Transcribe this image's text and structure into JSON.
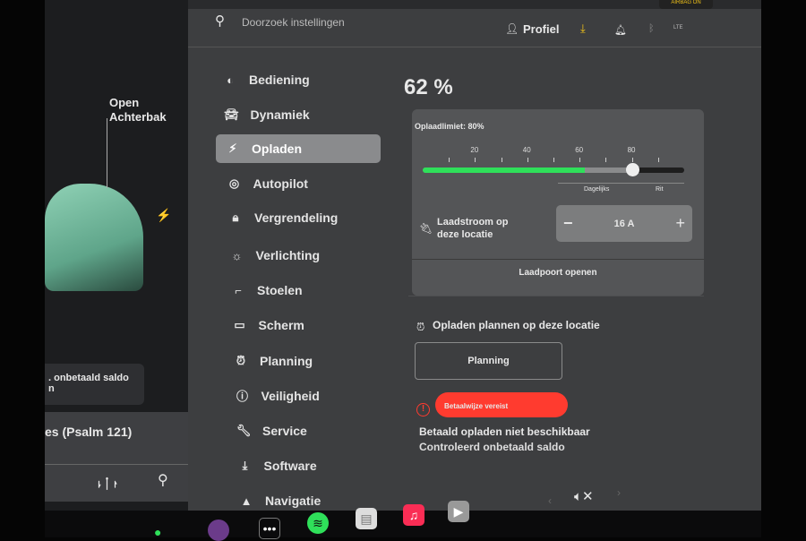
{
  "left_panel": {
    "trunk_label_1": "Open",
    "trunk_label_2": "Achterbak",
    "notice": ". onbetaald saldo",
    "notice_2": "n",
    "media_title": "es (Psalm 121)"
  },
  "header": {
    "search_placeholder": "Doorzoek instellingen",
    "profile": "Profiel",
    "airbag": "AIRBAG ON",
    "lte": "LTE"
  },
  "menu": [
    {
      "label": "Bediening",
      "icon": "toggle-icon"
    },
    {
      "label": "Dynamiek",
      "icon": "car-icon"
    },
    {
      "label": "Opladen",
      "icon": "bolt-icon",
      "active": true
    },
    {
      "label": "Autopilot",
      "icon": "steering-wheel-icon"
    },
    {
      "label": "Vergrendeling",
      "icon": "lock-icon"
    },
    {
      "label": "Verlichting",
      "icon": "sun-icon"
    },
    {
      "label": "Stoelen",
      "icon": "seat-icon"
    },
    {
      "label": "Scherm",
      "icon": "display-icon"
    },
    {
      "label": "Planning",
      "icon": "alarm-icon"
    },
    {
      "label": "Veiligheid",
      "icon": "alert-icon"
    },
    {
      "label": "Service",
      "icon": "wrench-icon"
    },
    {
      "label": "Software",
      "icon": "download-icon"
    },
    {
      "label": "Navigatie",
      "icon": "navigation-icon"
    }
  ],
  "charging": {
    "battery_percent": "62 %",
    "battery_level": 62,
    "limit_label": "Oplaadlimiet: 80%",
    "limit_value": 80,
    "ticks": [
      "20",
      "40",
      "60",
      "80"
    ],
    "range_daily": "Dagelijks",
    "range_trip": "Rit",
    "current_label_1": "Laadstroom op",
    "current_label_2": "deze locatie",
    "current_value": "16 A",
    "minus": "−",
    "plus": "+",
    "open_port": "Laadpoort openen",
    "schedule_title": "Opladen plannen op deze locatie",
    "schedule_button": "Planning",
    "payment_badge": "Betaalwijze vereist",
    "paid_unavailable": "Betaald opladen niet beschikbaar",
    "check_balance": "Controleerd onbetaald saldo"
  },
  "colors": {
    "accent_green": "#2fe05a",
    "alert_red": "#ff3b2f",
    "download_yellow": "#f5c518"
  }
}
